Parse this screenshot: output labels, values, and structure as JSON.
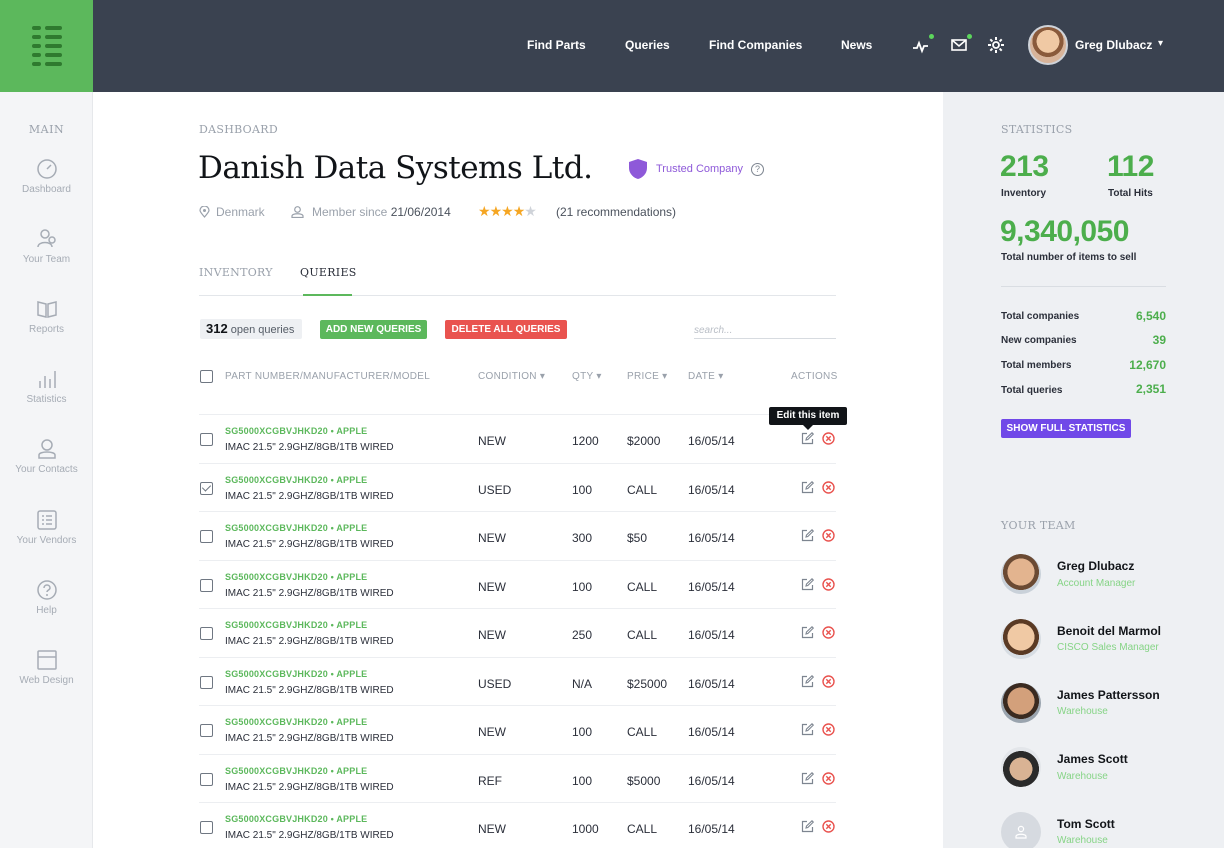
{
  "colors": {
    "accent": "#5cb85c",
    "topbar": "#3a4250",
    "danger": "#e9534f",
    "purple": "#7048e8",
    "trusted": "#8e59d9"
  },
  "topnav": {
    "links": [
      "Find Parts",
      "Queries",
      "Find Companies",
      "News"
    ],
    "icons": [
      "activity-icon",
      "mail-icon",
      "settings-icon"
    ],
    "user": {
      "name": "Greg Dlubacz",
      "menu_icon": "caret-down-icon"
    }
  },
  "sidebar": {
    "heading": "MAIN",
    "items": [
      {
        "label": "Dashboard",
        "icon": "gauge-icon"
      },
      {
        "label": "Your Team",
        "icon": "team-icon"
      },
      {
        "label": "Reports",
        "icon": "book-icon"
      },
      {
        "label": "Statistics",
        "icon": "bar-chart-icon"
      },
      {
        "label": "Your Contacts",
        "icon": "contact-icon"
      },
      {
        "label": "Your Vendors",
        "icon": "list-icon"
      },
      {
        "label": "Help",
        "icon": "help-icon"
      },
      {
        "label": "Web Design",
        "icon": "layout-icon"
      }
    ]
  },
  "main": {
    "breadcrumb": "DASHBOARD",
    "company": {
      "name": "Danish Data Systems Ltd.",
      "badge": "Trusted Company",
      "location": "Denmark",
      "member_since_label": "Member since",
      "member_since_date": "21/06/2014",
      "rating": 4,
      "rating_max": 5,
      "recommendations": "(21 recommendations)"
    },
    "tabs": [
      "INVENTORY",
      "QUERIES"
    ],
    "active_tab": "QUERIES",
    "toolbar": {
      "open_count": "312",
      "open_label": "open queries",
      "add_label": "ADD NEW QUERIES",
      "delete_label": "DELETE ALL QUERIES",
      "search_placeholder": "search..."
    },
    "table": {
      "headers": [
        "PART NUMBER/MANUFACTURER/MODEL",
        "CONDITION",
        "QTY",
        "PRICE",
        "DATE",
        "ACTIONS"
      ],
      "rows": [
        {
          "part": "SG5000XCGBVJHKD20  •  APPLE",
          "model": "IMAC 21.5\" 2.9GHZ/8GB/1TB WIRED",
          "condition": "NEW",
          "qty": "1200",
          "price": "$2000",
          "date": "16/05/14",
          "checked": false
        },
        {
          "part": "SG5000XCGBVJHKD20  •  APPLE",
          "model": "IMAC 21.5\" 2.9GHZ/8GB/1TB WIRED",
          "condition": "USED",
          "qty": "100",
          "price": "CALL",
          "date": "16/05/14",
          "checked": true
        },
        {
          "part": "SG5000XCGBVJHKD20  •  APPLE",
          "model": "IMAC 21.5\" 2.9GHZ/8GB/1TB WIRED",
          "condition": "NEW",
          "qty": "300",
          "price": "$50",
          "date": "16/05/14",
          "checked": false
        },
        {
          "part": "SG5000XCGBVJHKD20  •  APPLE",
          "model": "IMAC 21.5\" 2.9GHZ/8GB/1TB WIRED",
          "condition": "NEW",
          "qty": "100",
          "price": "CALL",
          "date": "16/05/14",
          "checked": false
        },
        {
          "part": "SG5000XCGBVJHKD20  •  APPLE",
          "model": "IMAC 21.5\" 2.9GHZ/8GB/1TB WIRED",
          "condition": "NEW",
          "qty": "250",
          "price": "CALL",
          "date": "16/05/14",
          "checked": false
        },
        {
          "part": "SG5000XCGBVJHKD20  •  APPLE",
          "model": "IMAC 21.5\" 2.9GHZ/8GB/1TB WIRED",
          "condition": "USED",
          "qty": "N/A",
          "price": "$25000",
          "date": "16/05/14",
          "checked": false
        },
        {
          "part": "SG5000XCGBVJHKD20  •  APPLE",
          "model": "IMAC 21.5\" 2.9GHZ/8GB/1TB WIRED",
          "condition": "NEW",
          "qty": "100",
          "price": "CALL",
          "date": "16/05/14",
          "checked": false
        },
        {
          "part": "SG5000XCGBVJHKD20  •  APPLE",
          "model": "IMAC 21.5\" 2.9GHZ/8GB/1TB WIRED",
          "condition": "REF",
          "qty": "100",
          "price": "$5000",
          "date": "16/05/14",
          "checked": false
        },
        {
          "part": "SG5000XCGBVJHKD20  •  APPLE",
          "model": "IMAC 21.5\" 2.9GHZ/8GB/1TB WIRED",
          "condition": "NEW",
          "qty": "1000",
          "price": "CALL",
          "date": "16/05/14",
          "checked": false
        }
      ],
      "tooltip": "Edit this item"
    }
  },
  "statistics": {
    "heading": "STATISTICS",
    "inventory_value": "213",
    "inventory_label": "Inventory",
    "hits_value": "112",
    "hits_label": "Total Hits",
    "items_value": "9,340,050",
    "items_label": "Total number of items to sell",
    "rows": [
      {
        "label": "Total companies",
        "value": "6,540"
      },
      {
        "label": "New companies",
        "value": "39"
      },
      {
        "label": "Total members",
        "value": "12,670"
      },
      {
        "label": "Total queries",
        "value": "2,351"
      }
    ],
    "button": "SHOW FULL STATISTICS"
  },
  "team": {
    "heading": "YOUR TEAM",
    "members": [
      {
        "name": "Greg Dlubacz",
        "role": "Account Manager"
      },
      {
        "name": "Benoit del Marmol",
        "role": "CISCO Sales Manager"
      },
      {
        "name": "James Pattersson",
        "role": "Warehouse"
      },
      {
        "name": "James Scott",
        "role": "Warehouse"
      },
      {
        "name": "Tom Scott",
        "role": "Warehouse"
      }
    ]
  }
}
